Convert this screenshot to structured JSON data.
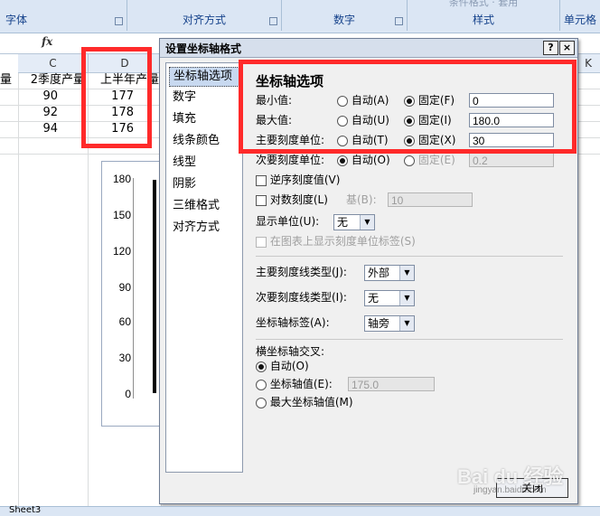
{
  "ribbon": {
    "groups": [
      "字体",
      "对齐方式",
      "数字",
      "样式",
      "单元格"
    ],
    "faint_label": "条件格式 · 套用"
  },
  "formula_bar": {
    "fx": "fx"
  },
  "sheet": {
    "col_headers": [
      "C",
      "D"
    ],
    "far_col": "K",
    "row_headers_left": [
      "量",
      "",
      ""
    ],
    "header_row": [
      "2季度产量",
      "上半年产量"
    ],
    "rows": [
      [
        "90",
        "177"
      ],
      [
        "92",
        "178"
      ],
      [
        "94",
        "176"
      ]
    ]
  },
  "chart_data": {
    "type": "bar",
    "ytick_labels": [
      "180",
      "150",
      "120",
      "90",
      "60",
      "30",
      "0"
    ],
    "ylim": [
      0,
      180
    ]
  },
  "dialog": {
    "title": "设置坐标轴格式",
    "help": "?",
    "close_x": "×",
    "nav": [
      "坐标轴选项",
      "数字",
      "填充",
      "线条颜色",
      "线型",
      "阴影",
      "三维格式",
      "对齐方式"
    ],
    "panel_title": "坐标轴选项",
    "axis_rows": [
      {
        "label": "最小值:",
        "auto": "自动(A)",
        "fixed": "固定(F)",
        "value": "0"
      },
      {
        "label": "最大值:",
        "auto": "自动(U)",
        "fixed": "固定(I)",
        "value": "180.0"
      },
      {
        "label": "主要刻度单位:",
        "auto": "自动(T)",
        "fixed": "固定(X)",
        "value": "30"
      },
      {
        "label": "次要刻度单位:",
        "auto": "自动(O)",
        "fixed": "固定(E)",
        "value": "0.2"
      }
    ],
    "reverse_label": "逆序刻度值(V)",
    "log_label": "对数刻度(L)",
    "base_label": "基(B):",
    "base_value": "10",
    "display_unit_label": "显示单位(U):",
    "display_unit_value": "无",
    "show_unit_label": "在图表上显示刻度单位标签(S)",
    "major_tick_label": "主要刻度线类型(J):",
    "major_tick_value": "外部",
    "minor_tick_label": "次要刻度线类型(I):",
    "minor_tick_value": "无",
    "axis_labels_label": "坐标轴标签(A):",
    "axis_labels_value": "轴旁",
    "cross_title": "横坐标轴交叉:",
    "cross_auto": "自动(O)",
    "cross_value_label": "坐标轴值(E):",
    "cross_value": "175.0",
    "cross_max": "最大坐标轴值(M)",
    "close_button": "关闭"
  },
  "watermark": {
    "text": "Bai du 经验",
    "sub": "jingyan.baidu.com"
  },
  "tabs": {
    "sheet": "Sheet3"
  }
}
